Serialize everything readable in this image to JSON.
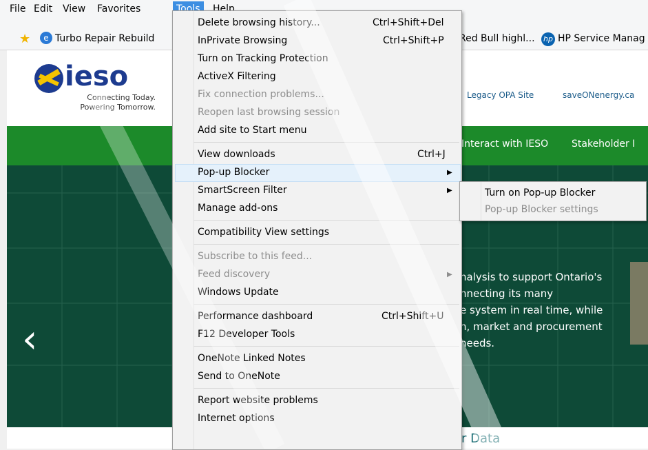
{
  "menubar": {
    "items": [
      "File",
      "Edit",
      "View",
      "Favorites",
      "Tools",
      "Help"
    ]
  },
  "favorites": {
    "items": [
      "Turbo Repair Rebuild",
      "Red Bull highl...",
      "HP Service Manag"
    ]
  },
  "site": {
    "logo_name": "ieso",
    "tagline_1": "Connecting Today.",
    "tagline_2": "Powering Tomorrow.",
    "top_links": [
      "Legacy OPA Site",
      "saveONenergy.ca"
    ],
    "nav": [
      "Interact with IESO",
      "Stakeholder I"
    ],
    "hero_lines": [
      "nalysis to support Ontario's",
      "nnecting its many",
      "e system in real time, while",
      "n, market and procurement",
      "needs."
    ],
    "carousel_prev": "‹",
    "section_title": "r Data"
  },
  "tools_menu": {
    "groups": [
      [
        {
          "label": "Delete browsing history...",
          "shortcut": "Ctrl+Shift+Del",
          "disabled": false
        },
        {
          "label": "InPrivate Browsing",
          "shortcut": "Ctrl+Shift+P",
          "disabled": false
        },
        {
          "label": "Turn on Tracking Protection",
          "shortcut": "",
          "disabled": false
        },
        {
          "label": "ActiveX Filtering",
          "shortcut": "",
          "disabled": false
        },
        {
          "label": "Fix connection problems...",
          "shortcut": "",
          "disabled": true
        },
        {
          "label": "Reopen last browsing session",
          "shortcut": "",
          "disabled": true
        },
        {
          "label": "Add site to Start menu",
          "shortcut": "",
          "disabled": false
        }
      ],
      [
        {
          "label": "View downloads",
          "shortcut": "Ctrl+J",
          "disabled": false
        },
        {
          "label": "Pop-up Blocker",
          "shortcut": "",
          "disabled": false,
          "submenu": true,
          "highlighted": true
        },
        {
          "label": "SmartScreen Filter",
          "shortcut": "",
          "disabled": false,
          "submenu": true
        },
        {
          "label": "Manage add-ons",
          "shortcut": "",
          "disabled": false
        }
      ],
      [
        {
          "label": "Compatibility View settings",
          "shortcut": "",
          "disabled": false
        }
      ],
      [
        {
          "label": "Subscribe to this feed...",
          "shortcut": "",
          "disabled": true
        },
        {
          "label": "Feed discovery",
          "shortcut": "",
          "disabled": true,
          "submenu": true
        },
        {
          "label": "Windows Update",
          "shortcut": "",
          "disabled": false
        }
      ],
      [
        {
          "label": "Performance dashboard",
          "shortcut": "Ctrl+Shift+U",
          "disabled": false
        },
        {
          "label": "F12 Developer Tools",
          "shortcut": "",
          "disabled": false
        }
      ],
      [
        {
          "label": "OneNote Linked Notes",
          "shortcut": "",
          "disabled": false
        },
        {
          "label": "Send to OneNote",
          "shortcut": "",
          "disabled": false
        }
      ],
      [
        {
          "label": "Report website problems",
          "shortcut": "",
          "disabled": false
        },
        {
          "label": "Internet options",
          "shortcut": "",
          "disabled": false
        }
      ]
    ]
  },
  "popup_submenu": {
    "items": [
      {
        "label": "Turn on Pop-up Blocker",
        "disabled": false
      },
      {
        "label": "Pop-up Blocker settings",
        "disabled": true
      }
    ]
  }
}
